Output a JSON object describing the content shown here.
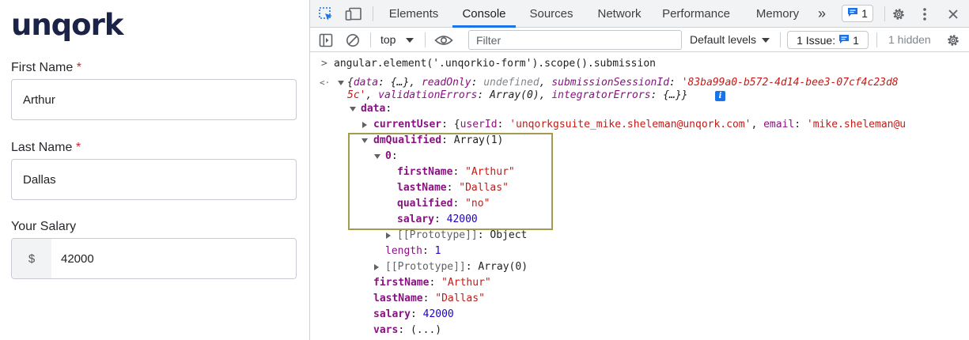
{
  "form": {
    "logo": "unqork",
    "first_name_label": "First Name",
    "first_name_value": "Arthur",
    "last_name_label": "Last Name",
    "last_name_value": "Dallas",
    "required_marker": "*",
    "salary_label": "Your Salary",
    "salary_prefix": "$",
    "salary_value": "42000"
  },
  "devtools": {
    "tabs": [
      "Elements",
      "Console",
      "Sources",
      "Network",
      "Performance",
      "Memory"
    ],
    "active_tab": "Console",
    "more_tabs": "»",
    "message_count": "1",
    "toolbar": {
      "context": "top",
      "filter_placeholder": "Filter",
      "levels": "Default levels",
      "issues_label": "1 Issue:",
      "issues_count": "1",
      "hidden": "1 hidden"
    },
    "colors": {
      "accent": "#1a73e8",
      "highlight_border": "#a39b4e"
    }
  },
  "console": {
    "command": "angular.element('.unqorkio-form').scope().submission",
    "result_l1": {
      "open": "{",
      "data_key": "data",
      "data_val": "{…}",
      "readonly_key": "readOnly",
      "readonly_val": "undefined",
      "session_key": "submissionSessionId",
      "session_val_a": "'83ba99a0-b572-4d14-bee3-07cf4c23d8"
    },
    "result_l2": {
      "session_val_b": "5c'",
      "validation_key": "validationErrors",
      "validation_val": "Array(0)",
      "integrator_key": "integratorErrors",
      "integrator_val": "{…}}"
    },
    "data_key": "data",
    "current_user": {
      "key": "currentUser",
      "userid_key": "userId",
      "userid_val": "'unqorkgsuite_mike.sheleman@unqork.com'",
      "email_key": "email",
      "email_val": "'mike.sheleman@u"
    },
    "dm_qualified": {
      "key": "dmQualified",
      "val": "Array(1)"
    },
    "index0": "0",
    "entry": {
      "first_key": "firstName",
      "first_val": "\"Arthur\"",
      "last_key": "lastName",
      "last_val": "\"Dallas\"",
      "qual_key": "qualified",
      "qual_val": "\"no\"",
      "salary_key": "salary",
      "salary_val": "42000"
    },
    "proto_object": {
      "key": "[[Prototype]]",
      "val": "Object"
    },
    "length": {
      "key": "length",
      "val": "1"
    },
    "proto_array": {
      "key": "[[Prototype]]",
      "val": "Array(0)"
    },
    "root": {
      "first_key": "firstName",
      "first_val": "\"Arthur\"",
      "last_key": "lastName",
      "last_val": "\"Dallas\"",
      "salary_key": "salary",
      "salary_val": "42000",
      "vars_key": "vars",
      "vars_val": "(...)"
    }
  }
}
